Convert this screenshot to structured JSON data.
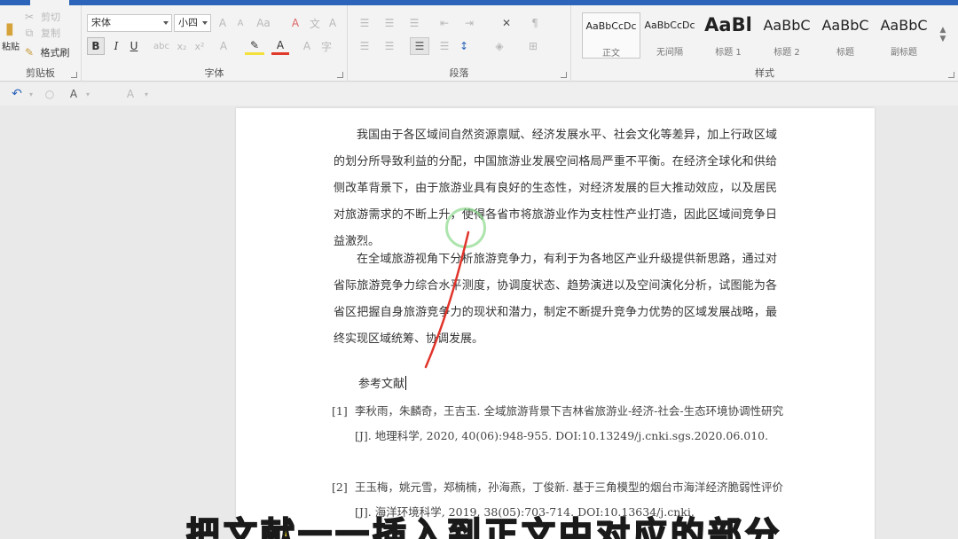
{
  "ribbon": {
    "clipboard": {
      "label": "剪贴板",
      "paste_label": "粘贴",
      "cut_label": "剪切",
      "copy_label": "复制",
      "painter_label": "格式刷"
    },
    "font": {
      "label": "字体",
      "font_name": "宋体",
      "font_size": "小四"
    },
    "paragraph": {
      "label": "段落"
    },
    "styles": {
      "label": "样式",
      "items": [
        {
          "sample": "AaBbCcDc",
          "name": "正文"
        },
        {
          "sample": "AaBbCcDc",
          "name": "无间隔"
        },
        {
          "sample": "AaBl",
          "name": "标题 1"
        },
        {
          "sample": "AaBbC",
          "name": "标题 2"
        },
        {
          "sample": "AaBbC",
          "name": "标题"
        },
        {
          "sample": "AaBbC",
          "name": "副标题"
        }
      ]
    }
  },
  "document": {
    "para1": "我国由于各区域间自然资源禀赋、经济发展水平、社会文化等差异，加上行政区域的划分所导致利益的分配，中国旅游业发展空间格局严重不平衡。在经济全球化和供给侧改革背景下，由于旅游业具有良好的生态性，对经济发展的巨大推动效应，以及居民对旅游需求的不断上升，使得各省市将旅游业作为支柱性产业打造，因此区域间竞争日益激烈。",
    "para2": "在全域旅游视角下分析旅游竞争力，有利于为各地区产业升级提供新思路，通过对省际旅游竞争力综合水平测度，协调度状态、趋势演进以及空间演化分析，试图能为各省区把握自身旅游竞争力的现状和潜力，制定不断提升竞争力优势的区域发展战略，最终实现区域统筹、协调发展。",
    "ref_heading": "参考文献",
    "refs": [
      {
        "num": "[1]",
        "text": "李秋雨，朱麟奇，王吉玉. 全域旅游背景下吉林省旅游业-经济-社会-生态环境协调性研究[J]. 地理科学, 2020, 40(06):948-955. DOI:10.13249/j.cnki.sgs.2020.06.010."
      },
      {
        "num": "[2]",
        "text": "王玉梅，姚元雪，郑楠楠，孙海燕，丁俊新. 基于三角模型的烟台市海洋经济脆弱性评价[J]. 海洋环境科学, 2019, 38(05):703-714. DOI:10.13634/j.cnki."
      }
    ]
  },
  "caption": "把文献一一插入到正文中对应的部分"
}
